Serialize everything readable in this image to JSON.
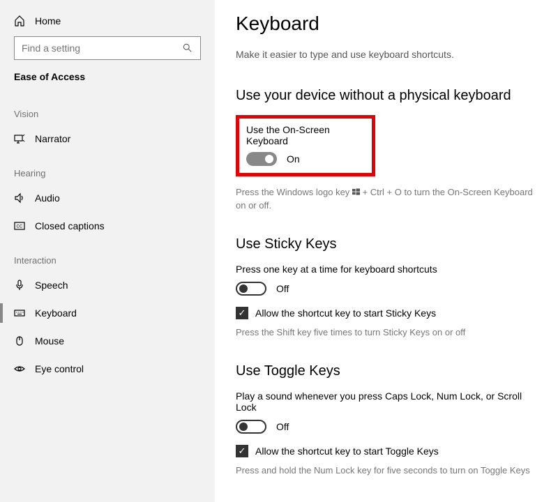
{
  "sidebar": {
    "home": "Home",
    "search_placeholder": "Find a setting",
    "section_title": "Ease of Access",
    "groups": [
      {
        "label": "Vision",
        "items": [
          {
            "icon": "narrator",
            "label": "Narrator"
          }
        ]
      },
      {
        "label": "Hearing",
        "items": [
          {
            "icon": "audio",
            "label": "Audio"
          },
          {
            "icon": "cc",
            "label": "Closed captions"
          }
        ]
      },
      {
        "label": "Interaction",
        "items": [
          {
            "icon": "speech",
            "label": "Speech"
          },
          {
            "icon": "keyboard",
            "label": "Keyboard",
            "active": true
          },
          {
            "icon": "mouse",
            "label": "Mouse"
          },
          {
            "icon": "eye",
            "label": "Eye control"
          }
        ]
      }
    ]
  },
  "main": {
    "title": "Keyboard",
    "subtitle": "Make it easier to type and use keyboard shortcuts.",
    "onscreen": {
      "section_title": "Use your device without a physical keyboard",
      "option_label": "Use the On-Screen Keyboard",
      "toggle_state": "On",
      "hint_prefix": "Press the Windows logo key ",
      "hint_suffix": " + Ctrl + O to turn the On-Screen Keyboard on or off."
    },
    "sticky": {
      "section_title": "Use Sticky Keys",
      "desc": "Press one key at a time for keyboard shortcuts",
      "toggle_state": "Off",
      "check_label": "Allow the shortcut key to start Sticky Keys",
      "hint": "Press the Shift key five times to turn Sticky Keys on or off"
    },
    "togglekeys": {
      "section_title": "Use Toggle Keys",
      "desc": "Play a sound whenever you press Caps Lock, Num Lock, or Scroll Lock",
      "toggle_state": "Off",
      "check_label": "Allow the shortcut key to start Toggle Keys",
      "hint": "Press and hold the Num Lock key for five seconds to turn on Toggle Keys"
    }
  }
}
